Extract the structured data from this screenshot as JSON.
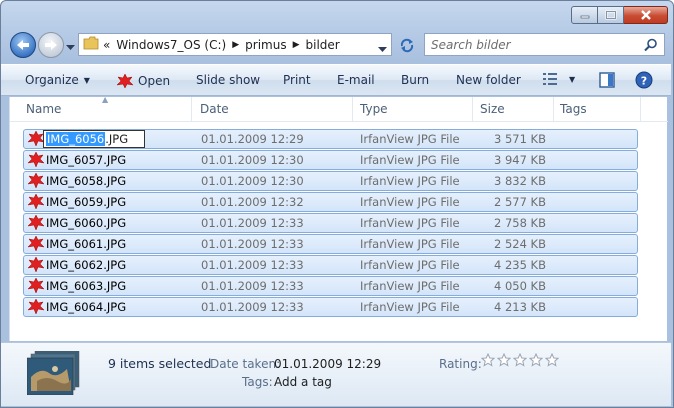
{
  "address": {
    "crumbs": [
      "Windows7_OS (C:)",
      "primus",
      "bilder"
    ],
    "overflow": "«"
  },
  "search": {
    "placeholder": "Search bilder"
  },
  "toolbar": {
    "organize": "Organize",
    "open": "Open",
    "slideshow": "Slide show",
    "print": "Print",
    "email": "E-mail",
    "burn": "Burn",
    "new_folder": "New folder"
  },
  "columns": {
    "name": "Name",
    "date": "Date",
    "type": "Type",
    "size": "Size",
    "tags": "Tags"
  },
  "files": [
    {
      "name_sel": "IMG_6056",
      "ext": ".JPG",
      "date": "01.01.2009 12:29",
      "type": "IrfanView JPG File",
      "size": "3 571 KB"
    },
    {
      "name": "IMG_6057.JPG",
      "date": "01.01.2009 12:30",
      "type": "IrfanView JPG File",
      "size": "3 947 KB"
    },
    {
      "name": "IMG_6058.JPG",
      "date": "01.01.2009 12:30",
      "type": "IrfanView JPG File",
      "size": "3 832 KB"
    },
    {
      "name": "IMG_6059.JPG",
      "date": "01.01.2009 12:32",
      "type": "IrfanView JPG File",
      "size": "2 577 KB"
    },
    {
      "name": "IMG_6060.JPG",
      "date": "01.01.2009 12:33",
      "type": "IrfanView JPG File",
      "size": "2 758 KB"
    },
    {
      "name": "IMG_6061.JPG",
      "date": "01.01.2009 12:33",
      "type": "IrfanView JPG File",
      "size": "2 524 KB"
    },
    {
      "name": "IMG_6062.JPG",
      "date": "01.01.2009 12:33",
      "type": "IrfanView JPG File",
      "size": "4 235 KB"
    },
    {
      "name": "IMG_6063.JPG",
      "date": "01.01.2009 12:33",
      "type": "IrfanView JPG File",
      "size": "4 050 KB"
    },
    {
      "name": "IMG_6064.JPG",
      "date": "01.01.2009 12:33",
      "type": "IrfanView JPG File",
      "size": "4 213 KB"
    }
  ],
  "details": {
    "selected": "9 items selected",
    "date_taken_label": "Date taken:",
    "date_taken_value": "01.01.2009 12:29",
    "tags_label": "Tags:",
    "tags_value": "Add a tag",
    "rating_label": "Rating:",
    "rating_stars": 0
  },
  "icons": {
    "file": "irfanview-file-icon",
    "folder": "folder-icon",
    "open": "irfanview-icon",
    "views": "views-icon",
    "preview_pane": "preview-pane-icon",
    "help": "help-icon"
  }
}
